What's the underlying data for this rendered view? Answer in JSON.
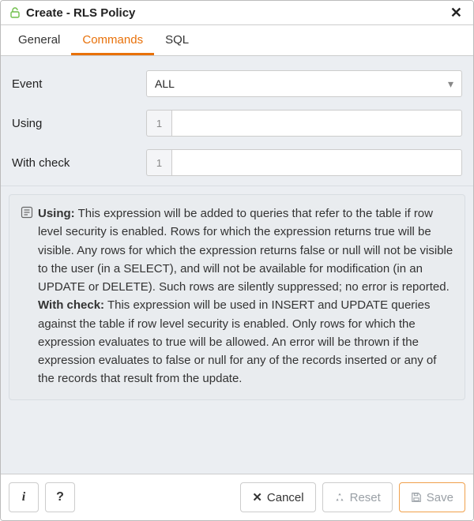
{
  "title": "Create - RLS Policy",
  "tabs": [
    {
      "label": "General",
      "active": false
    },
    {
      "label": "Commands",
      "active": true
    },
    {
      "label": "SQL",
      "active": false
    }
  ],
  "form": {
    "event": {
      "label": "Event",
      "value": "ALL"
    },
    "using": {
      "label": "Using",
      "line_no": "1",
      "value": ""
    },
    "withcheck": {
      "label": "With check",
      "line_no": "1",
      "value": ""
    }
  },
  "help": {
    "using_label": "Using:",
    "using_text": "This expression will be added to queries that refer to the table if row level security is enabled. Rows for which the expression returns true will be visible. Any rows for which the expression returns false or null will not be visible to the user (in a SELECT), and will not be available for modification (in an UPDATE or DELETE). Such rows are silently suppressed; no error is reported.",
    "withcheck_label": "With check:",
    "withcheck_text": "This expression will be used in INSERT and UPDATE queries against the table if row level security is enabled. Only rows for which the expression evaluates to true will be allowed. An error will be thrown if the expression evaluates to false or null for any of the records inserted or any of the records that result from the update."
  },
  "footer": {
    "info_label": "i",
    "help_label": "?",
    "cancel_label": "Cancel",
    "reset_label": "Reset",
    "save_label": "Save"
  }
}
